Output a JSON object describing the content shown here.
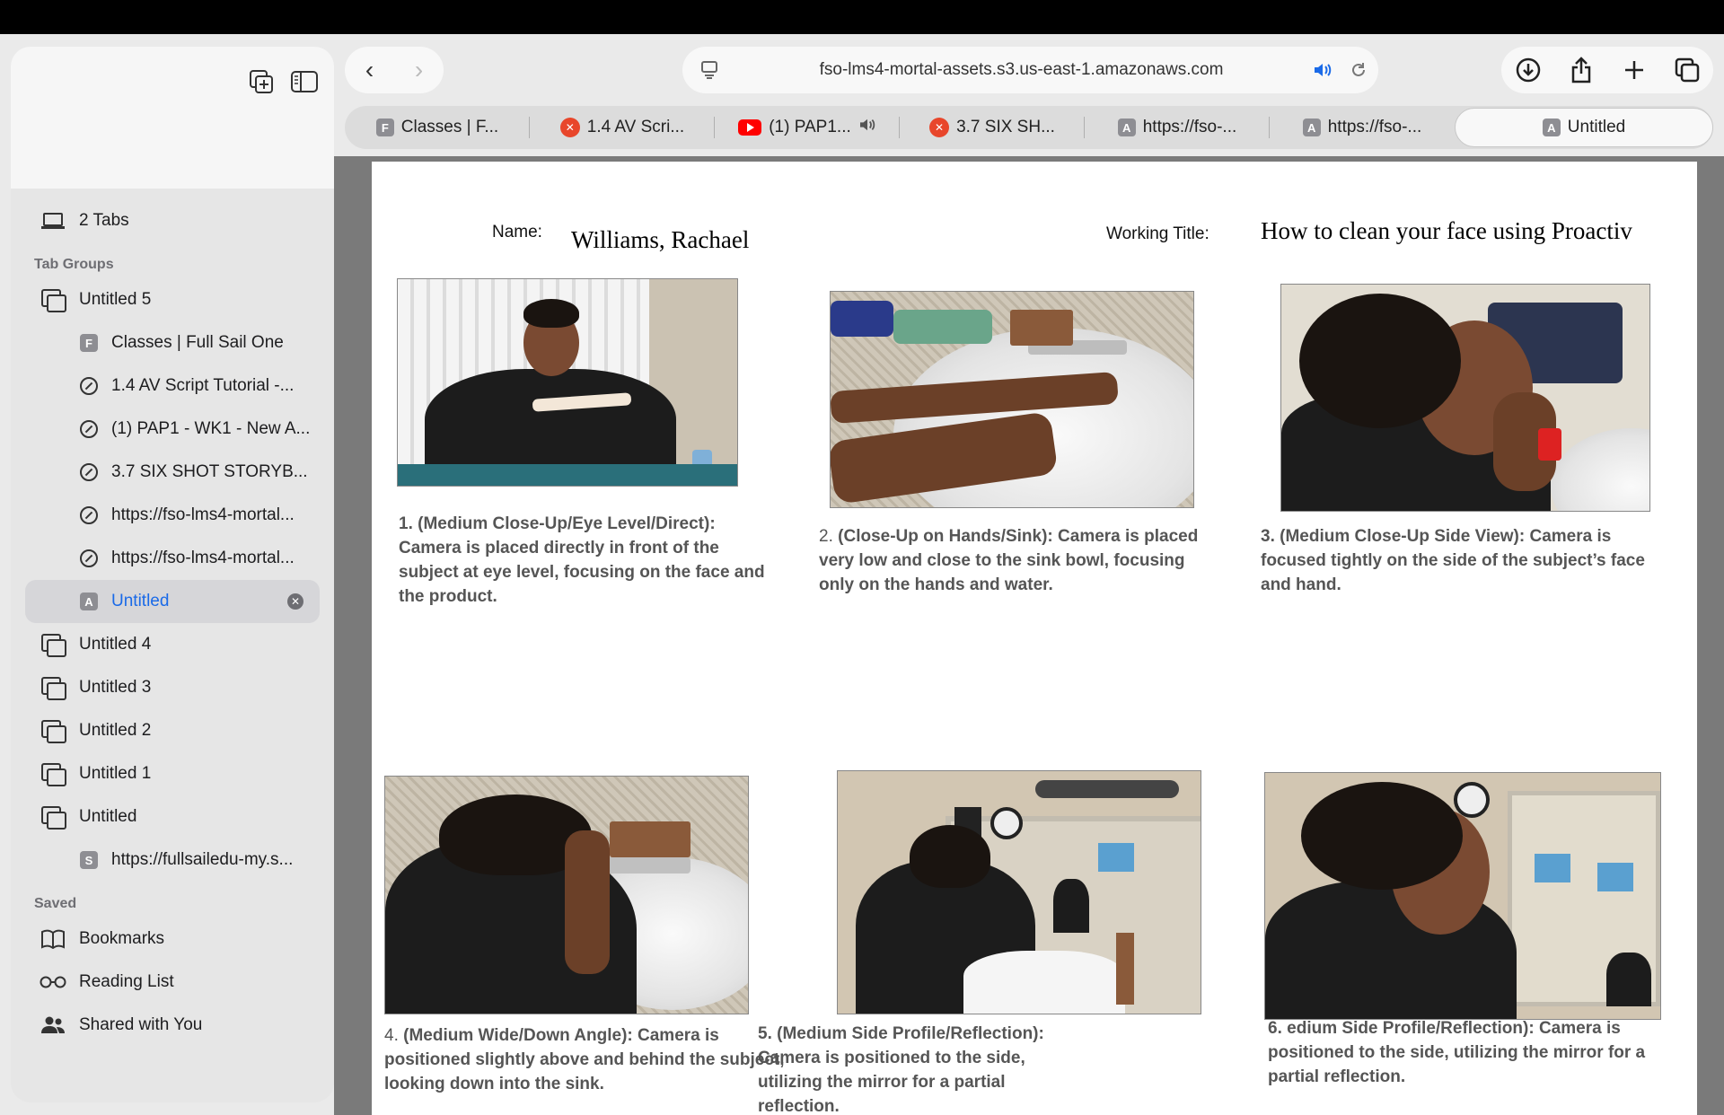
{
  "sidebar": {
    "tabs_count": "2 Tabs",
    "section_tab_groups": "Tab Groups",
    "groups": [
      {
        "label": "Untitled 5"
      },
      {
        "label": "Untitled 4"
      },
      {
        "label": "Untitled 3"
      },
      {
        "label": "Untitled 2"
      },
      {
        "label": "Untitled 1"
      },
      {
        "label": "Untitled"
      }
    ],
    "children_group5": [
      {
        "label": "Classes | Full Sail One",
        "fav": "F"
      },
      {
        "label": "1.4 AV Script Tutorial -..."
      },
      {
        "label": "(1) PAP1 - WK1 - New A..."
      },
      {
        "label": "3.7 SIX SHOT STORYB..."
      },
      {
        "label": "https://fso-lms4-mortal..."
      },
      {
        "label": "https://fso-lms4-mortal..."
      },
      {
        "label": "Untitled",
        "fav": "A"
      }
    ],
    "children_untitled": [
      {
        "label": "https://fullsailedu-my.s...",
        "fav": "S"
      }
    ],
    "section_saved": "Saved",
    "saved": [
      {
        "label": "Bookmarks"
      },
      {
        "label": "Reading List"
      },
      {
        "label": "Shared with You"
      }
    ]
  },
  "toolbar": {
    "url": "fso-lms4-mortal-assets.s3.us-east-1.amazonaws.com"
  },
  "tabs": [
    {
      "label": "Classes | F...",
      "fav": "F"
    },
    {
      "label": "1.4 AV Scri..."
    },
    {
      "label": "(1) PAP1..."
    },
    {
      "label": "3.7 SIX SH..."
    },
    {
      "label": "https://fso-...",
      "fav": "A"
    },
    {
      "label": "https://fso-...",
      "fav": "A"
    },
    {
      "label": "Untitled",
      "fav": "A"
    }
  ],
  "document": {
    "name_label": "Name:",
    "name_value": "Williams, Rachael",
    "working_title_label": "Working Title:",
    "working_title_value": "How to clean your face using Proactiv",
    "shots": [
      {
        "num": "1.",
        "text": "(Medium Close-Up/Eye Level/Direct): Camera is placed directly in front of the subject at eye level, focusing on the face and the product."
      },
      {
        "num": "2.",
        "text": "(Close-Up on Hands/Sink): Camera is placed very low and close to the sink bowl, focusing only on the hands and water."
      },
      {
        "num": "3.",
        "text": "(Medium Close-Up Side View): Camera is focused tightly on the side of the subject’s face and hand."
      },
      {
        "num": "4.",
        "text": "(Medium Wide/Down Angle): Camera is positioned slightly above and behind the subject, looking down into the sink."
      },
      {
        "num": "5.",
        "text": "(Medium Side Profile/Reflection): Camera is positioned to the side, utilizing the mirror for a partial reflection."
      },
      {
        "num": "6.",
        "text": "edium Side Profile/Reflection): Camera is positioned to the side, utilizing the mirror for a partial reflection."
      }
    ]
  }
}
